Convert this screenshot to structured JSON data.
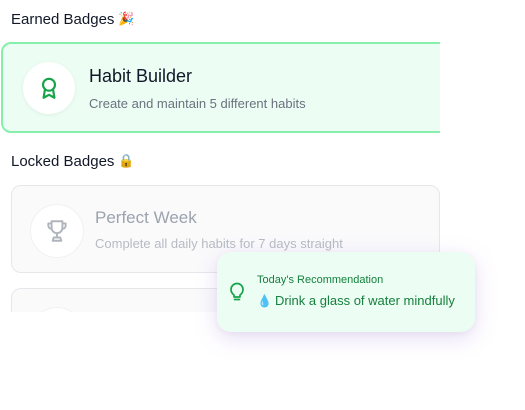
{
  "earned_section": {
    "title": "Earned Badges",
    "emoji": "🎉"
  },
  "earned_badges": [
    {
      "title": "Habit Builder",
      "description": "Create and maintain 5 different habits",
      "icon": "award-ribbon-icon"
    }
  ],
  "locked_section": {
    "title": "Locked Badges",
    "emoji": "🔒"
  },
  "locked_badges": [
    {
      "title": "Perfect Week",
      "description": "Complete all daily habits for 7 days straight",
      "icon": "trophy-icon"
    }
  ],
  "recommendation": {
    "heading": "Today's Recommendation",
    "emoji": "💧",
    "text": "Drink a glass of water mindfully",
    "icon": "lightbulb-icon"
  },
  "colors": {
    "accent_green": "#16a34a",
    "earned_bg": "#ecfdf3",
    "earned_border": "#86efac",
    "locked_text": "#9ca3af"
  }
}
